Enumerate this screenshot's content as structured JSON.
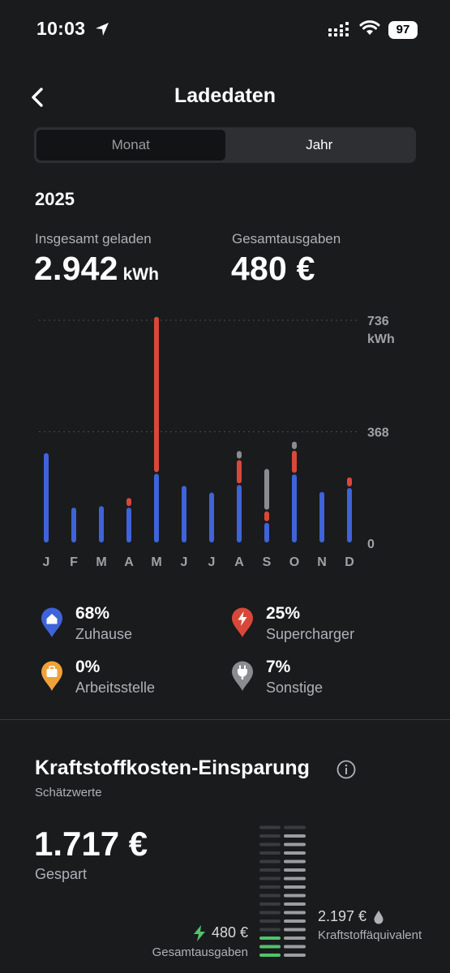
{
  "status_bar": {
    "time": "10:03",
    "battery": "97"
  },
  "header": {
    "title": "Ladedaten"
  },
  "period_tabs": {
    "month": "Monat",
    "year": "Jahr",
    "selected": "Jahr"
  },
  "year": "2025",
  "totals": {
    "charged_label": "Insgesamt geladen",
    "charged_value": "2.942",
    "charged_unit": "kWh",
    "spend_label": "Gesamtausgaben",
    "spend_value": "480 €"
  },
  "colors": {
    "home": "#3f63d8",
    "supercharger": "#d8483a",
    "work": "#f0a23a",
    "other": "#8c8c90",
    "saving": "#4fc46a"
  },
  "chart_data": {
    "type": "bar",
    "stacked": true,
    "categories": [
      "J",
      "F",
      "M",
      "A",
      "M",
      "J",
      "J",
      "A",
      "S",
      "O",
      "N",
      "D"
    ],
    "series": [
      {
        "name": "Zuhause",
        "values": [
          300,
          120,
          125,
          120,
          232,
          192,
          170,
          195,
          70,
          230,
          172,
          185
        ]
      },
      {
        "name": "Supercharger",
        "values": [
          0,
          0,
          0,
          32,
          518,
          0,
          0,
          82,
          38,
          78,
          0,
          35
        ]
      },
      {
        "name": "Sonstige",
        "values": [
          0,
          0,
          0,
          0,
          0,
          0,
          0,
          30,
          140,
          30,
          0,
          0
        ]
      }
    ],
    "ylim": [
      0,
      736
    ],
    "yticks": [
      {
        "value": 736,
        "label": "736",
        "unit": "kWh"
      },
      {
        "value": 368,
        "label": "368"
      },
      {
        "value": 0,
        "label": "0"
      }
    ]
  },
  "legend": [
    {
      "pct": "68%",
      "name": "Zuhause",
      "icon": "home-pin-icon"
    },
    {
      "pct": "25%",
      "name": "Supercharger",
      "icon": "supercharger-pin-icon"
    },
    {
      "pct": "0%",
      "name": "Arbeitsstelle",
      "icon": "work-pin-icon"
    },
    {
      "pct": "7%",
      "name": "Sonstige",
      "icon": "plug-pin-icon"
    }
  ],
  "fuel_savings": {
    "title": "Kraftstoffkosten-Einsparung",
    "subtitle": "Schätzwerte",
    "saved_value": "1.717 €",
    "saved_label": "Gespart",
    "spend_value": "480 €",
    "spend_label": "Gesamtausgaben",
    "equivalent_value": "2.197 €",
    "equivalent_label": "Kraftstoffäquivalent",
    "gauge": {
      "total_bars": 16,
      "left_filled": 3,
      "right_filled": 15
    }
  }
}
